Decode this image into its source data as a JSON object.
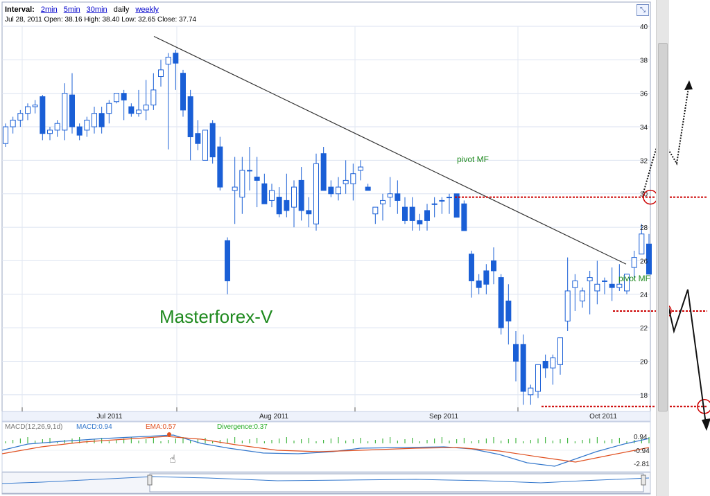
{
  "header": {
    "interval_label": "Interval:",
    "interval_links": [
      "2min",
      "5min",
      "30min"
    ],
    "interval_selected": "daily",
    "interval_weekly": "weekly",
    "ohlc_line": "Jul 28, 2011 Open: 38.16 High: 38.40 Low: 32.65 Close: 37.74"
  },
  "watermark": "Masterforex-V",
  "annotations": {
    "pivot_top": "pivot MF",
    "pivot_mid": "pivot MF"
  },
  "macd_labels": {
    "params": "MACD(12,26,9,1d)",
    "macd": "MACD:0.94",
    "ema": "EMA:0.57",
    "divergence": "Divergence:0.37",
    "tick_top": "0.94",
    "tick_mid": "-0.94",
    "tick_bottom": "-2.81"
  },
  "colors": {
    "candle": "#1a5fd6",
    "trendline": "#333333",
    "pivot_line": "#cc0000",
    "watermark": "#1f8a1f",
    "macd": "#3377cc",
    "ema": "#e05020",
    "divergence": "#22aa22"
  },
  "chart_data": {
    "type": "candlestick",
    "title": "",
    "xlabel": "",
    "ylabel": "",
    "ylim": [
      17,
      40
    ],
    "y_ticks": [
      18,
      20,
      22,
      24,
      26,
      28,
      30,
      32,
      34,
      36,
      38,
      40
    ],
    "x_tick_labels": [
      "Jul 2011",
      "Aug 2011",
      "Sep 2011",
      "Oct 2011"
    ],
    "grid": true,
    "series": [
      {
        "values": [
          [
            33.0,
            34.2,
            32.8,
            34.0
          ],
          [
            34.0,
            34.6,
            33.6,
            34.4
          ],
          [
            34.4,
            35.0,
            34.0,
            34.8
          ],
          [
            34.8,
            35.4,
            34.4,
            35.2
          ],
          [
            35.2,
            35.6,
            34.8,
            35.3
          ],
          [
            35.8,
            35.9,
            33.2,
            33.6
          ],
          [
            33.6,
            34.0,
            33.2,
            33.8
          ],
          [
            33.8,
            34.4,
            33.4,
            34.2
          ],
          [
            33.8,
            36.6,
            33.2,
            36.0
          ],
          [
            35.9,
            37.2,
            33.6,
            34.0
          ],
          [
            34.0,
            34.2,
            33.2,
            33.5
          ],
          [
            33.8,
            34.6,
            33.4,
            34.4
          ],
          [
            34.0,
            35.2,
            33.6,
            34.8
          ],
          [
            34.8,
            35.2,
            33.6,
            34.0
          ],
          [
            34.8,
            35.6,
            34.2,
            35.4
          ],
          [
            35.5,
            36.0,
            35.4,
            36.0
          ],
          [
            36.0,
            36.2,
            34.4,
            35.6
          ],
          [
            35.2,
            35.4,
            34.6,
            34.8
          ],
          [
            34.8,
            36.2,
            34.6,
            35.0
          ],
          [
            35.0,
            36.8,
            34.4,
            35.3
          ],
          [
            35.3,
            37.2,
            35.0,
            36.2
          ],
          [
            37.0,
            38.0,
            36.4,
            37.4
          ],
          [
            37.74,
            38.4,
            32.65,
            38.16
          ],
          [
            38.4,
            38.6,
            36.2,
            37.8
          ],
          [
            37.2,
            37.4,
            34.6,
            35.0
          ],
          [
            35.8,
            36.2,
            32.0,
            33.4
          ],
          [
            33.6,
            34.4,
            32.6,
            33.0
          ],
          [
            32.0,
            33.8,
            32.6,
            33.8
          ],
          [
            34.2,
            34.4,
            31.8,
            32.2
          ],
          [
            32.8,
            33.4,
            30.2,
            30.4
          ],
          [
            27.2,
            27.4,
            24.0,
            24.8
          ],
          [
            30.2,
            32.2,
            28.2,
            30.4
          ],
          [
            29.8,
            32.2,
            28.8,
            31.4
          ],
          [
            31.4,
            32.8,
            30.2,
            31.4
          ],
          [
            31.0,
            32.2,
            29.2,
            30.8
          ],
          [
            30.6,
            31.2,
            29.4,
            29.4
          ],
          [
            29.6,
            30.6,
            29.2,
            30.2
          ],
          [
            29.8,
            30.4,
            28.6,
            28.8
          ],
          [
            29.6,
            31.2,
            28.6,
            29.0
          ],
          [
            29.2,
            30.8,
            28.0,
            30.4
          ],
          [
            30.8,
            31.6,
            28.4,
            29.0
          ],
          [
            29.0,
            29.8,
            28.0,
            28.8
          ],
          [
            28.2,
            32.4,
            27.8,
            31.8
          ],
          [
            32.4,
            32.8,
            30.2,
            30.2
          ],
          [
            30.4,
            30.8,
            29.8,
            30.0
          ],
          [
            30.0,
            31.0,
            29.6,
            30.4
          ],
          [
            30.6,
            32.0,
            30.0,
            30.8
          ],
          [
            30.6,
            31.8,
            29.6,
            31.2
          ],
          [
            31.4,
            32.0,
            30.8,
            31.6
          ],
          [
            30.4,
            30.6,
            30.2,
            30.2
          ],
          [
            28.8,
            29.2,
            28.2,
            29.2
          ],
          [
            29.4,
            30.0,
            28.4,
            29.6
          ],
          [
            29.8,
            31.0,
            29.2,
            30.0
          ],
          [
            30.0,
            30.8,
            28.8,
            29.6
          ],
          [
            29.2,
            29.8,
            28.2,
            28.4
          ],
          [
            29.2,
            29.8,
            27.8,
            28.4
          ],
          [
            28.4,
            28.8,
            27.8,
            28.2
          ],
          [
            29.0,
            29.4,
            27.8,
            28.4
          ],
          [
            29.4,
            29.8,
            28.6,
            29.4
          ],
          [
            29.6,
            29.8,
            28.8,
            29.6
          ],
          [
            29.8,
            30.0,
            28.8,
            29.8
          ],
          [
            30.0,
            30.0,
            28.6,
            28.6
          ],
          [
            29.4,
            29.6,
            27.8,
            27.8
          ],
          [
            26.4,
            26.6,
            23.8,
            24.8
          ],
          [
            24.8,
            25.2,
            24.0,
            24.4
          ],
          [
            25.4,
            25.8,
            24.0,
            24.6
          ],
          [
            26.0,
            26.8,
            24.6,
            25.4
          ],
          [
            25.0,
            25.2,
            21.6,
            22.0
          ],
          [
            23.6,
            24.6,
            21.0,
            22.4
          ],
          [
            21.0,
            21.8,
            18.8,
            20.0
          ],
          [
            21.0,
            21.6,
            17.4,
            18.2
          ],
          [
            18.0,
            18.6,
            17.4,
            18.4
          ],
          [
            18.2,
            19.8,
            17.8,
            19.8
          ],
          [
            20.0,
            20.4,
            19.0,
            19.6
          ],
          [
            19.6,
            20.4,
            18.6,
            20.2
          ],
          [
            19.8,
            21.4,
            19.2,
            21.4
          ],
          [
            22.4,
            26.2,
            21.8,
            24.2
          ],
          [
            24.4,
            25.2,
            23.0,
            24.8
          ],
          [
            23.6,
            24.4,
            23.2,
            24.2
          ],
          [
            24.8,
            25.4,
            22.8,
            25.0
          ],
          [
            24.2,
            26.0,
            23.4,
            24.6
          ],
          [
            24.8,
            25.0,
            24.0,
            24.8
          ],
          [
            24.6,
            25.6,
            23.6,
            24.4
          ],
          [
            24.4,
            25.8,
            24.2,
            24.6
          ],
          [
            24.2,
            24.8,
            24.0,
            25.2
          ],
          [
            25.6,
            26.6,
            25.0,
            26.2
          ],
          [
            26.4,
            28.2,
            26.4,
            27.6
          ],
          [
            27.0,
            27.6,
            25.2,
            25.2
          ]
        ]
      },
      {
        "name": "MACD(12,26,9,1d)",
        "label": "MACD",
        "last": 0.94
      },
      {
        "name": "EMA",
        "last": 0.57
      },
      {
        "name": "Divergence",
        "last": 0.37
      }
    ],
    "annotations": {
      "trendline": {
        "from_high": 39.4,
        "to": 25.8
      },
      "pivot_levels": [
        29.8,
        23.0,
        17.3
      ]
    }
  }
}
